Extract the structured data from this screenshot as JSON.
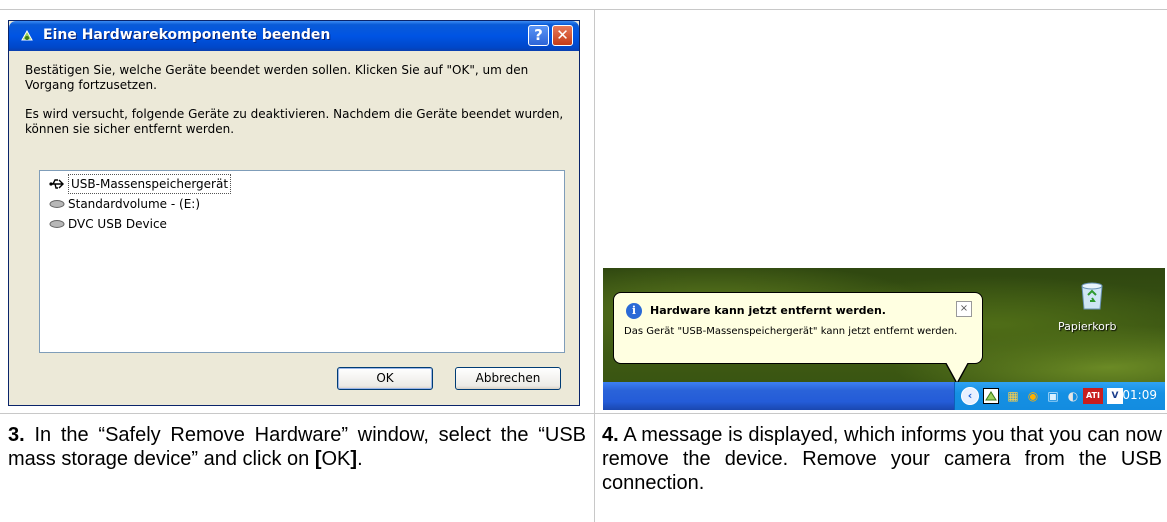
{
  "dialog": {
    "title": "Eine Hardwarekomponente beenden",
    "help": "?",
    "close": "✕",
    "text1": "Bestätigen Sie, welche Geräte beendet werden sollen. Klicken Sie auf \"OK\", um den Vorgang fortzusetzen.",
    "text2": "Es wird versucht, folgende Geräte zu deaktivieren. Nachdem die Geräte beendet wurden, können sie sicher entfernt werden.",
    "items": [
      {
        "label": "USB-Massenspeichergerät",
        "icon": "usb-icon"
      },
      {
        "label": "Standardvolume - (E:)",
        "icon": "drive-icon"
      },
      {
        "label": "DVC USB Device",
        "icon": "drive-icon"
      }
    ],
    "ok": "OK",
    "cancel": "Abbrechen"
  },
  "notification": {
    "title": "Hardware kann jetzt entfernt werden.",
    "close": "×",
    "text": "Das Gerät \"USB-Massenspeichergerät\" kann jetzt entfernt werden.",
    "recycle_bin": "Papierkorb",
    "clock": "01:09",
    "tray_arrow": "‹"
  },
  "captions": {
    "step3_num": "3.",
    "step3_text1": " In the “Safely Remove Hardware” window, select the “USB mass storage device” and click on ",
    "step3_bracket_open": "[",
    "step3_ok": "OK",
    "step3_bracket_close": "]",
    "step3_end": ".",
    "step4_num": "4.",
    "step4_text": " A message is displayed, which informs you that you can now remove the device. Remove your camera from the USB connection."
  }
}
